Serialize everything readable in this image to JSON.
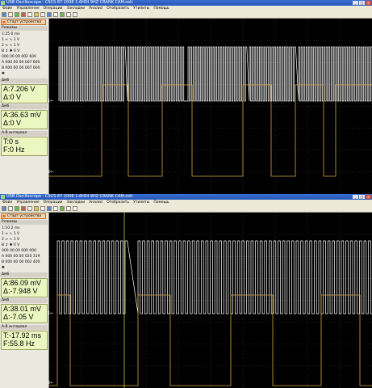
{
  "windows": [
    {
      "title": "USB Oscilloscope - CSCS 87 2008 1.6HDI 9HZ CRANK CAM.oslt",
      "menu": [
        "Файл",
        "Управление",
        "Операции",
        "Закладки",
        "Анализ",
        "Отобразить",
        "Утилиты",
        "Помощь"
      ],
      "start_button": "Старт устройства",
      "mode_label": "Режимы",
      "rows": [
        "1:25   0 ms",
        "1 ≈ ∿  1 V",
        "2 ≈ ∿  1 V",
        "B ↕ ✱  0 V",
        "000 00 00 002 600",
        "A 000 00 00 007 600",
        "B 000 00 00 007 600"
      ],
      "delta_header": "Δмб",
      "a_value": "A:7.206 V",
      "delta_value": "Δ:0 V",
      "delta2_header": "Δмб",
      "a2_value": "A:36.63 mV",
      "delta2_value": "Δ:0 V",
      "ab_header": "A-B интервал",
      "t_value": "T:0 s",
      "f_value": "F:0 Hz",
      "ch1_label": "1←",
      "ch2_label": "2←"
    },
    {
      "title": "USB Oscilloscope - CSCS 87 2008 1.6HDI 9HZ CRANK CAM.oslt",
      "menu": [
        "Файл",
        "Управление",
        "Операции",
        "Закладки",
        "Анализ",
        "Отобразить",
        "Утилиты",
        "Помощь"
      ],
      "start_button": "Старт устройства",
      "mode_label": "Режимы",
      "rows": [
        "1:10   2 ms",
        "1 ≈ ∿  1 V",
        "2 ≈ ∿  1 V",
        "B ↕ ✱  0 V",
        "000 00 00 000 000",
        "A 000 00 00 020 319",
        "B 000 00 00 002 400"
      ],
      "delta_header": "Δмб",
      "a_value": "A:86.09 mV",
      "delta_value": "Δ:-7.948 V",
      "delta2_header": "Δмб",
      "a2_value": "A:38.01 mV",
      "delta2_value": "Δ:-7.05 V",
      "ab_header": "A-B интервал",
      "t_value": "T:-17.92 ms",
      "f_value": "F:55.8 Hz",
      "ch1_label": "1←",
      "ch2_label": "2←"
    }
  ],
  "colors": {
    "ch1": "#ffffff",
    "ch2": "#d9a443",
    "grid": "#3a3a3a",
    "cursor": "#c9c23a"
  }
}
